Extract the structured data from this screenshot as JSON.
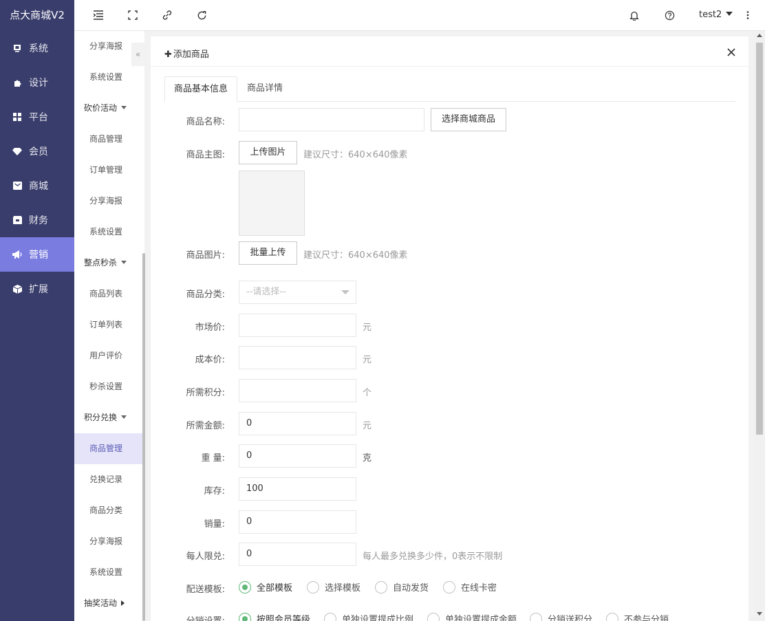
{
  "brand": "点大商城V2",
  "nav": [
    {
      "label": "系统",
      "icon": "monitor-icon"
    },
    {
      "label": "设计",
      "icon": "puzzle-icon"
    },
    {
      "label": "平台",
      "icon": "grid-icon"
    },
    {
      "label": "会员",
      "icon": "diamond-icon"
    },
    {
      "label": "商城",
      "icon": "mail-icon"
    },
    {
      "label": "财务",
      "icon": "wallet-icon"
    },
    {
      "label": "营销",
      "icon": "megaphone-icon",
      "active": true
    },
    {
      "label": "扩展",
      "icon": "cube-icon"
    }
  ],
  "topbar": {
    "icons": [
      "menu-fold-icon",
      "fullscreen-icon",
      "link-icon",
      "refresh-icon"
    ],
    "user": "test2"
  },
  "submenu": {
    "collapse": "«",
    "items": [
      {
        "type": "item",
        "label": "分享海报"
      },
      {
        "type": "item",
        "label": "系统设置"
      },
      {
        "type": "group",
        "label": "砍价活动"
      },
      {
        "type": "item",
        "label": "商品管理"
      },
      {
        "type": "item",
        "label": "订单管理"
      },
      {
        "type": "item",
        "label": "分享海报"
      },
      {
        "type": "item",
        "label": "系统设置"
      },
      {
        "type": "group",
        "label": "整点秒杀"
      },
      {
        "type": "item",
        "label": "商品列表"
      },
      {
        "type": "item",
        "label": "订单列表"
      },
      {
        "type": "item",
        "label": "用户评价"
      },
      {
        "type": "item",
        "label": "秒杀设置"
      },
      {
        "type": "group",
        "label": "积分兑换"
      },
      {
        "type": "item",
        "label": "商品管理",
        "active": true
      },
      {
        "type": "item",
        "label": "兑换记录"
      },
      {
        "type": "item",
        "label": "商品分类"
      },
      {
        "type": "item",
        "label": "分享海报"
      },
      {
        "type": "item",
        "label": "系统设置"
      },
      {
        "type": "group-collapsed",
        "label": "抽奖活动"
      }
    ]
  },
  "panel": {
    "title": "添加商品",
    "tabs": [
      "商品基本信息",
      "商品详情"
    ]
  },
  "form": {
    "name_label": "商品名称:",
    "name_value": "",
    "choose_btn": "选择商城商品",
    "main_img_label": "商品主图:",
    "upload_btn": "上传图片",
    "main_img_hint": "建议尺寸：640×640像素",
    "pics_label": "商品图片:",
    "batch_btn": "批量上传",
    "pics_hint": "建议尺寸：640×640像素",
    "category_label": "商品分类:",
    "category_placeholder": "--请选择--",
    "market_label": "市场价:",
    "market_value": "",
    "market_unit": "元",
    "cost_label": "成本价:",
    "cost_value": "",
    "cost_unit": "元",
    "score_label": "所需积分:",
    "score_value": "",
    "score_unit": "个",
    "money_label": "所需金额:",
    "money_value": "0",
    "money_unit": "元",
    "weight_label": "重 量:",
    "weight_value": "0",
    "weight_unit": "克",
    "stock_label": "库存:",
    "stock_value": "100",
    "sales_label": "销量:",
    "sales_value": "0",
    "limit_label": "每人限兑:",
    "limit_value": "0",
    "limit_hint": "每人最多兑换多少件，0表示不限制",
    "delivery_label": "配送模板:",
    "delivery_options": [
      "全部模板",
      "选择模板",
      "自动发货",
      "在线卡密"
    ],
    "delivery_selected": 0,
    "commission_label": "分销设置:",
    "commission_options": [
      "按照会员等级",
      "单独设置提成比例",
      "单独设置提成金额",
      "分销送积分",
      "不参与分销"
    ],
    "commission_selected": 0
  }
}
